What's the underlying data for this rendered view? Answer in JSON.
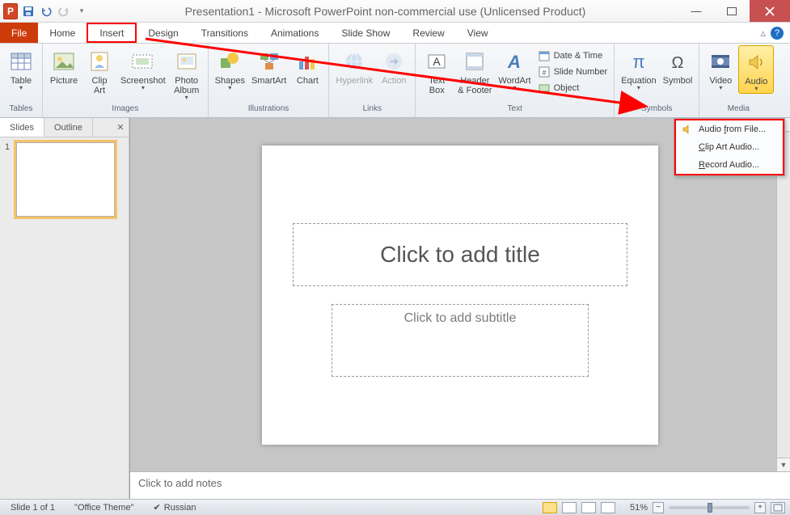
{
  "title": "Presentation1 - Microsoft PowerPoint non-commercial use (Unlicensed Product)",
  "tabs": {
    "file": "File",
    "home": "Home",
    "insert": "Insert",
    "design": "Design",
    "transitions": "Transitions",
    "animations": "Animations",
    "slideshow": "Slide Show",
    "review": "Review",
    "view": "View"
  },
  "ribbon": {
    "tables": {
      "label": "Tables",
      "table": "Table"
    },
    "images": {
      "label": "Images",
      "picture": "Picture",
      "clipart": "Clip\nArt",
      "screenshot": "Screenshot",
      "photoalbum": "Photo\nAlbum"
    },
    "illustrations": {
      "label": "Illustrations",
      "shapes": "Shapes",
      "smartart": "SmartArt",
      "chart": "Chart"
    },
    "links": {
      "label": "Links",
      "hyperlink": "Hyperlink",
      "action": "Action"
    },
    "text": {
      "label": "Text",
      "textbox": "Text\nBox",
      "headerfooter": "Header\n& Footer",
      "wordart": "WordArt",
      "datetime": "Date & Time",
      "slidenumber": "Slide Number",
      "object": "Object"
    },
    "symbols": {
      "label": "Symbols",
      "equation": "Equation",
      "symbol": "Symbol"
    },
    "media": {
      "label": "Media",
      "video": "Video",
      "audio": "Audio"
    }
  },
  "audio_menu": {
    "from_file": "Audio from File...",
    "clipart": "Clip Art Audio...",
    "record": "Record Audio..."
  },
  "slides_pane": {
    "slides_tab": "Slides",
    "outline_tab": "Outline",
    "thumb1_number": "1"
  },
  "slide": {
    "title_placeholder": "Click to add title",
    "subtitle_placeholder": "Click to add subtitle"
  },
  "notes": {
    "placeholder": "Click to add notes"
  },
  "status": {
    "slide": "Slide 1 of 1",
    "theme": "\"Office Theme\"",
    "lang": "Russian",
    "zoom": "51%"
  }
}
